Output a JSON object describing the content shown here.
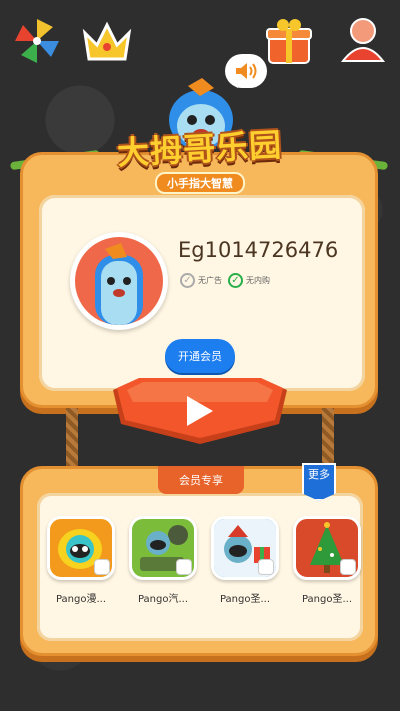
{
  "header": {
    "icons": [
      "pinwheel-icon",
      "crown-icon",
      "gift-icon",
      "user-icon",
      "speaker-icon"
    ]
  },
  "logo": {
    "title": "大拇哥乐园",
    "subtitle": "小手指大智慧"
  },
  "profile": {
    "user_id": "Eg1014726476",
    "no_ads_label": "无广告",
    "no_iap_label": "无内购",
    "vip_button_label": "开通会员"
  },
  "members": {
    "title": "会员专享",
    "more_label": "更多",
    "apps": [
      {
        "name": "Pango漫...",
        "color": "#f39a1c"
      },
      {
        "name": "Pango汽...",
        "color": "#7bbd3a"
      },
      {
        "name": "Pango圣...",
        "color": "#4aa8d8"
      },
      {
        "name": "Pango圣...",
        "color": "#d84a2a"
      }
    ]
  },
  "colors": {
    "background": "#2e2e2e",
    "card": "#f7b85c",
    "card_inner": "#fff6e3",
    "vip_button": "#1d7ef0",
    "play_button": "#f2562a",
    "accent_check": "#27b04a"
  }
}
